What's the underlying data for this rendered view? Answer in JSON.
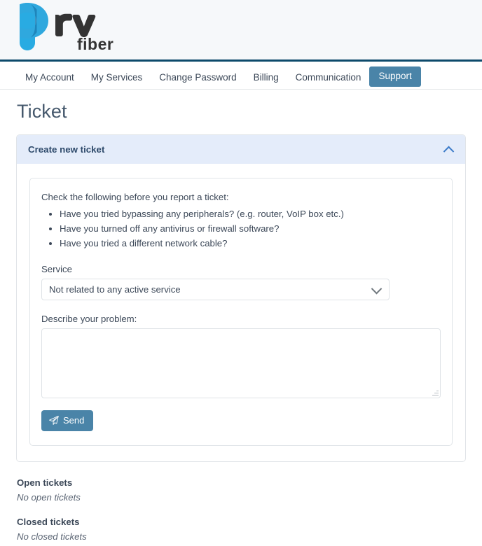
{
  "brand": {
    "name": "prv",
    "sub": "fiber",
    "logo_blue": "#29abe2",
    "logo_blue_dark": "#1b7fb5",
    "logo_dark": "#333333",
    "header_bg": "#f6f8fa",
    "header_rule": "#0d4a6b"
  },
  "nav": {
    "items": [
      {
        "label": "My Account",
        "active": false
      },
      {
        "label": "My Services",
        "active": false
      },
      {
        "label": "Change Password",
        "active": false
      },
      {
        "label": "Billing",
        "active": false
      },
      {
        "label": "Communication",
        "active": false
      },
      {
        "label": "Support",
        "active": true
      }
    ],
    "active_bg": "#4a84a8",
    "active_fg": "#ffffff"
  },
  "page": {
    "title": "Ticket"
  },
  "panel": {
    "header_title": "Create new ticket",
    "header_bg": "#e4ecfa",
    "toggle_icon": "chevron-up-icon",
    "expanded": true
  },
  "form": {
    "check_intro": "Check the following before you report a ticket:",
    "check_items": [
      "Have you tried bypassing any peripherals? (e.g. router, VoIP box etc.)",
      "Have you turned off any antivirus or firewall software?",
      "Have you tried a different network cable?"
    ],
    "service_label": "Service",
    "service_value": "Not related to any active service",
    "service_options": [
      "Not related to any active service"
    ],
    "service_icon": "chevron-down-icon",
    "describe_label": "Describe your problem:",
    "describe_value": "",
    "describe_placeholder": "",
    "send_label": "Send",
    "send_icon": "paper-plane-icon",
    "send_bg": "#4a84a8"
  },
  "tickets": {
    "open": {
      "title": "Open tickets",
      "empty": "No open tickets"
    },
    "closed": {
      "title": "Closed tickets",
      "empty": "No closed tickets"
    }
  }
}
